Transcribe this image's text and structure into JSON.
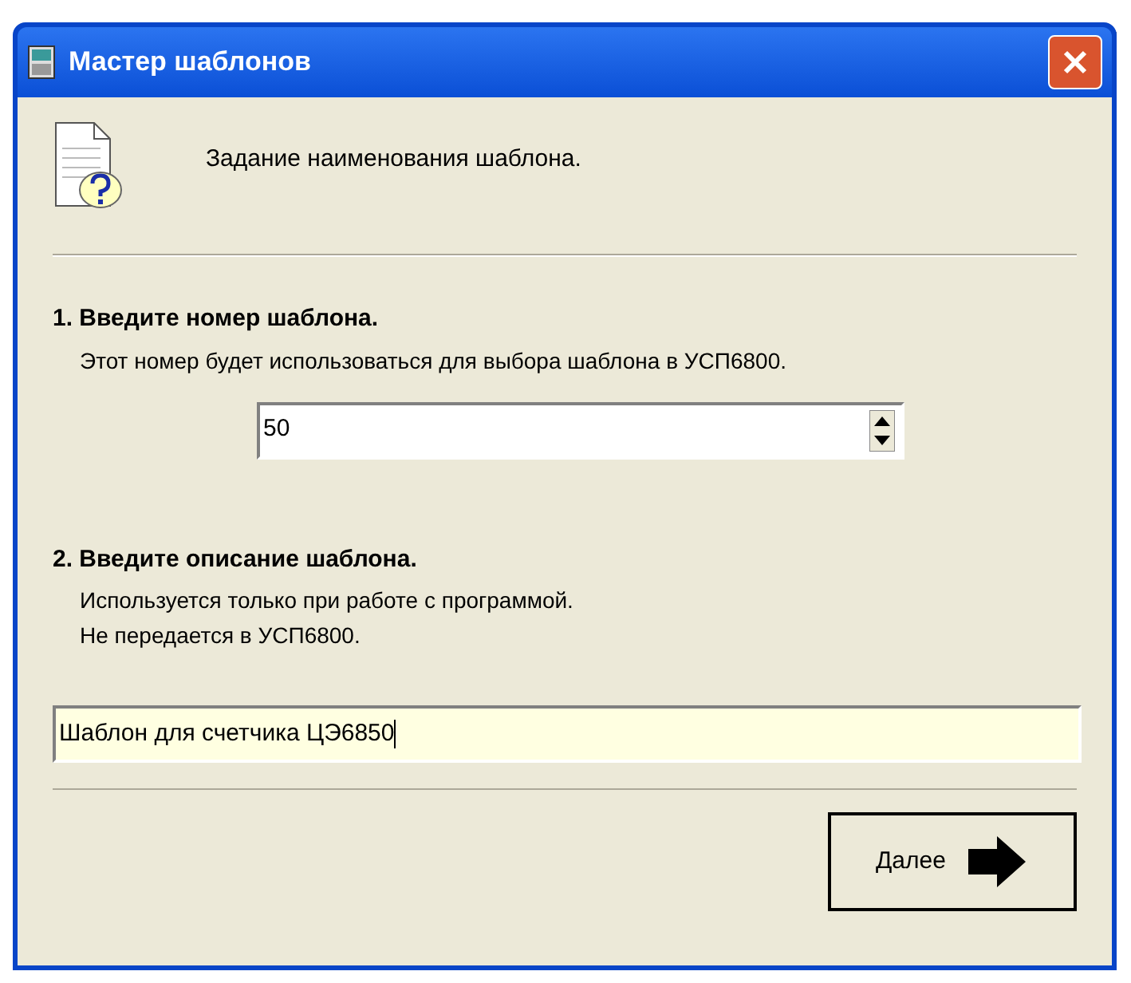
{
  "window": {
    "title": "Мастер шаблонов"
  },
  "header": {
    "text": "Задание наименования шаблона."
  },
  "steps": [
    {
      "title": "1. Введите номер шаблона.",
      "hints": [
        "Этот номер будет использоваться для выбора шаблона в УСП6800."
      ],
      "field": {
        "kind": "spin",
        "value": "50"
      }
    },
    {
      "title": "2. Введите описание шаблона.",
      "hints": [
        "Используется только при работе с программой.",
        "Не передается в УСП6800."
      ],
      "field": {
        "kind": "text",
        "value": "Шаблон для счетчика ЦЭ6850"
      }
    }
  ],
  "buttons": [
    {
      "label": "Далее"
    }
  ]
}
